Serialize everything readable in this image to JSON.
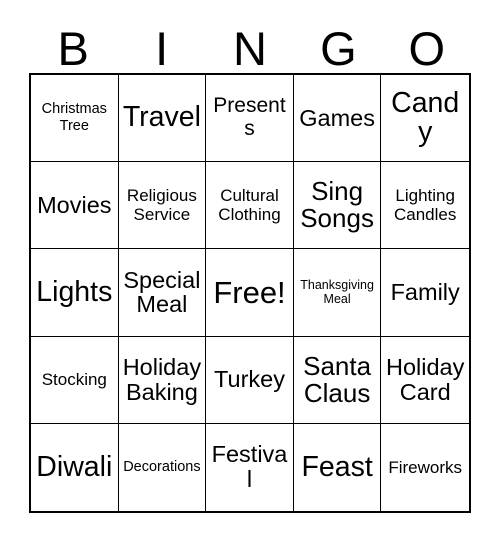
{
  "card": {
    "title": "BINGO",
    "free_space_label": "Free!",
    "colors": {
      "background": "#ffffff",
      "cell_background": "#ffffff",
      "border": "#000000",
      "text": "#000000"
    }
  },
  "header": {
    "letters": [
      "B",
      "I",
      "N",
      "G",
      "O"
    ]
  },
  "grid": {
    "columns": 5,
    "rows": 5,
    "cells": [
      [
        {
          "text": "Christmas Tree",
          "size": "xs",
          "free": false
        },
        {
          "text": "Travel",
          "size": "xl",
          "free": false
        },
        {
          "text": "Presents",
          "size": "m",
          "free": false
        },
        {
          "text": "Games",
          "size": "ml",
          "free": false
        },
        {
          "text": "Candy",
          "size": "xl",
          "free": false
        }
      ],
      [
        {
          "text": "Movies",
          "size": "ml",
          "free": false
        },
        {
          "text": "Religious Service",
          "size": "s",
          "free": false
        },
        {
          "text": "Cultural Clothing",
          "size": "s",
          "free": false
        },
        {
          "text": "Sing Songs",
          "size": "l",
          "free": false
        },
        {
          "text": "Lighting Candles",
          "size": "s",
          "free": false
        }
      ],
      [
        {
          "text": "Lights",
          "size": "xl",
          "free": false
        },
        {
          "text": "Special Meal",
          "size": "ml",
          "free": false
        },
        {
          "text": "Free!",
          "size": "xxl",
          "free": true
        },
        {
          "text": "Thanksgiving Meal",
          "size": "xxs",
          "free": false
        },
        {
          "text": "Family",
          "size": "ml",
          "free": false
        }
      ],
      [
        {
          "text": "Stocking",
          "size": "s",
          "free": false
        },
        {
          "text": "Holiday Baking",
          "size": "ml",
          "free": false
        },
        {
          "text": "Turkey",
          "size": "ml",
          "free": false
        },
        {
          "text": "Santa Claus",
          "size": "l",
          "free": false
        },
        {
          "text": "Holiday Card",
          "size": "ml",
          "free": false
        }
      ],
      [
        {
          "text": "Diwali",
          "size": "xl",
          "free": false
        },
        {
          "text": "Decorations",
          "size": "xs",
          "free": false
        },
        {
          "text": "Festival",
          "size": "ml",
          "free": false
        },
        {
          "text": "Feast",
          "size": "xl",
          "free": false
        },
        {
          "text": "Fireworks",
          "size": "s",
          "free": false
        }
      ]
    ]
  }
}
